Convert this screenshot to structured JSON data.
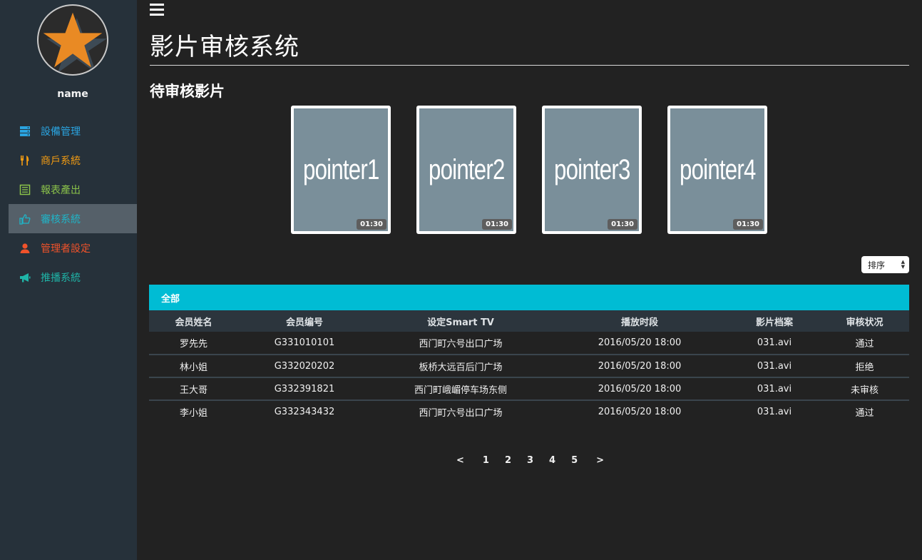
{
  "user": {
    "name": "name"
  },
  "sidebar": {
    "items": [
      {
        "label": "設備管理",
        "color": "#2aa4e0",
        "icon": "server-icon"
      },
      {
        "label": "商戶系統",
        "color": "#f39c12",
        "icon": "fork-knife-icon"
      },
      {
        "label": "報表產出",
        "color": "#8bc34a",
        "icon": "list-icon"
      },
      {
        "label": "審核系統",
        "color": "#1fb5c8",
        "icon": "thumbs-up-icon",
        "active": true
      },
      {
        "label": "管理者設定",
        "color": "#f0522a",
        "icon": "user-icon"
      },
      {
        "label": "推播系統",
        "color": "#1fb5a8",
        "icon": "megaphone-icon"
      }
    ]
  },
  "header": {
    "title": "影片审核系统"
  },
  "pending": {
    "title": "待审核影片",
    "videos": [
      {
        "label": "pointer1",
        "duration": "01:30"
      },
      {
        "label": "pointer2",
        "duration": "01:30"
      },
      {
        "label": "pointer3",
        "duration": "01:30"
      },
      {
        "label": "pointer4",
        "duration": "01:30"
      }
    ]
  },
  "sort": {
    "label": "排序"
  },
  "tab": {
    "label": "全部"
  },
  "table": {
    "columns": [
      "会员姓名",
      "会员编号",
      "设定Smart TV",
      "播放时段",
      "影片档案",
      "审核状况"
    ],
    "rows": [
      [
        "罗先先",
        "G331010101",
        "西门町六号出口广场",
        "2016/05/20 18:00",
        "031.avi",
        "通过"
      ],
      [
        "林小姐",
        "G332020202",
        "板桥大远百后门广场",
        "2016/05/20 18:00",
        "031.avi",
        "拒绝"
      ],
      [
        "王大哥",
        "G332391821",
        "西门町峨嵋停车场东侧",
        "2016/05/20 18:00",
        "031.avi",
        "未审核"
      ],
      [
        "李小姐",
        "G332343432",
        "西门町六号出口广场",
        "2016/05/20 18:00",
        "031.avi",
        "通过"
      ]
    ]
  },
  "pagination": {
    "prev": "<",
    "pages": [
      "1",
      "2",
      "3",
      "4",
      "5"
    ],
    "next": ">"
  },
  "colors": {
    "accent": "#00bcd4",
    "sidebar_bg": "#26313a",
    "page_bg": "#222222"
  }
}
